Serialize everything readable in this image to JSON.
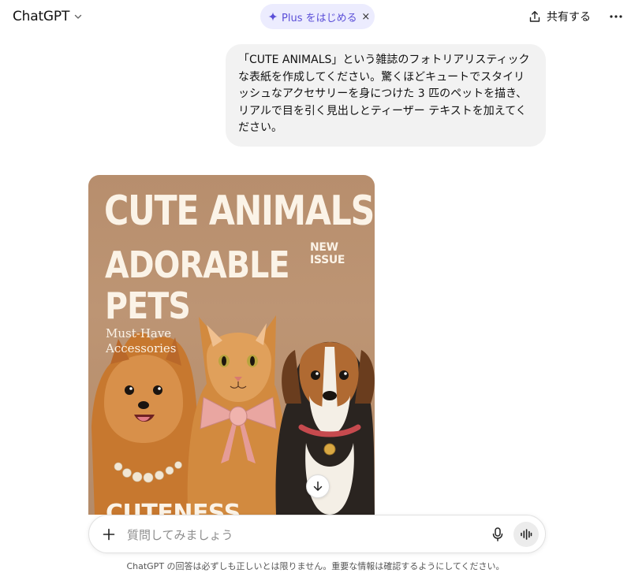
{
  "header": {
    "model_name": "ChatGPT",
    "plus_label": "Plus をはじめる",
    "plus_close": "×",
    "share_label": "共有する"
  },
  "conversation": {
    "user_message": "「CUTE ANIMALS」という雑誌のフォトリアリスティックな表紙を作成してください。驚くほどキュートでスタイリッシュなアクセサリーを身につけた 3 匹のペットを描き、リアルで目を引く見出しとティーザー テキストを加えてください。",
    "generated_image": {
      "masthead": "CUTE ANIMALS",
      "issue_badge": "NEW ISSUE",
      "headline_line1": "ADORABLE",
      "headline_line2": "PETS",
      "subhead_line1": "Must-Have",
      "subhead_line2": "Accessories",
      "footer_text": "CUTENESS"
    }
  },
  "composer": {
    "placeholder": "質問してみましょう"
  },
  "footer": {
    "disclaimer": "ChatGPT の回答は必ずしも正しいとは限りません。重要な情報は確認するようにしてください。"
  },
  "colors": {
    "accent": "#5b4fd8",
    "plus_pill_bg": "#ececfe",
    "bubble_bg": "#f2f2f2",
    "cover_bg": "#b78e6d",
    "cover_text": "#fbf3e7"
  },
  "icons": [
    "chevron-down-icon",
    "sparkle-icon",
    "close-icon",
    "share-icon",
    "more-icon",
    "arrow-down-icon",
    "plus-icon",
    "microphone-icon",
    "voice-mode-icon"
  ]
}
